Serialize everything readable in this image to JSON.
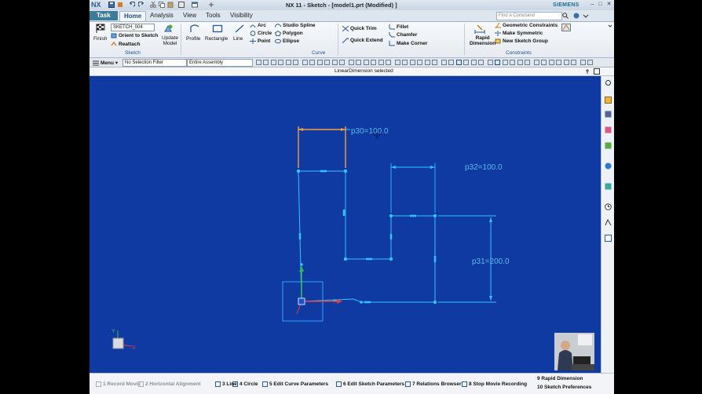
{
  "window": {
    "logo": "NX",
    "title": "NX 11 - Sketch - [model1.prt (Modified) ]",
    "brand": "SIEMENS",
    "search_placeholder": "Find a Command"
  },
  "tabs": [
    {
      "label": "Task"
    },
    {
      "label": "Home"
    },
    {
      "label": "Analysis"
    },
    {
      "label": "View"
    },
    {
      "label": "Tools"
    },
    {
      "label": "Visibility"
    }
  ],
  "ribbon": {
    "finish": "Finish",
    "sketch_name": "SKETCH_004",
    "orient_to_sketch": "Orient to Sketch",
    "reattach": "Reattach",
    "update_model": "Update",
    "update_model2": "Model",
    "group_sketch": "Sketch",
    "profile": "Profile",
    "rectangle": "Rectangle",
    "line": "Line",
    "arc": "Arc",
    "circle": "Circle",
    "point": "Point",
    "studio_spline": "Studio Spline",
    "polygon": "Polygon",
    "ellipse": "Ellipse",
    "group_curve": "Curve",
    "quick_trim": "Quick Trim",
    "quick_extend": "Quick Extend",
    "fillet": "Fillet",
    "chamfer": "Chamfer",
    "make_corner": "Make Corner",
    "rapid_dimension": "Rapid",
    "rapid_dimension2": "Dimension",
    "geometric_constraints": "Geometric Constraints",
    "make_symmetric": "Make Symmetric",
    "new_sketch_group": "New Sketch Group",
    "group_constraints": "Constraints"
  },
  "filterbar": {
    "menu": "Menu",
    "selection_filter": "No Selection Filter",
    "assembly_scope": "Entire Assembly"
  },
  "status": {
    "message": "LinearDimension selected"
  },
  "dimensions": {
    "p30": "p30=100.0",
    "p32": "p32=100.0",
    "p31": "p31=200.0"
  },
  "cue_items": [
    {
      "label": "1 Record Movie",
      "dim": true
    },
    {
      "label": "2 Horizontal Alignment",
      "dim": true
    },
    {
      "label": "3 Line",
      "dim": false
    },
    {
      "label": "4 Circle",
      "dim": false
    },
    {
      "label": "5 Edit Curve Parameters",
      "dim": false
    },
    {
      "label": "6 Edit Sketch Parameters",
      "dim": false
    },
    {
      "label": "7 Relations Browser",
      "dim": false
    },
    {
      "label": "8 Stop Movie Recording",
      "dim": false
    }
  ],
  "cue_right": {
    "rapid_dimension": "9 Rapid Dimension",
    "sketch_preferences": "10 Sketch Preferences"
  },
  "colors": {
    "canvas": "#0f3aa2",
    "sketch_line": "#35c3ff",
    "selected_dim": "#f0a040",
    "dim_text": "#5fb8f0",
    "tab_active": "#3b7d99"
  }
}
